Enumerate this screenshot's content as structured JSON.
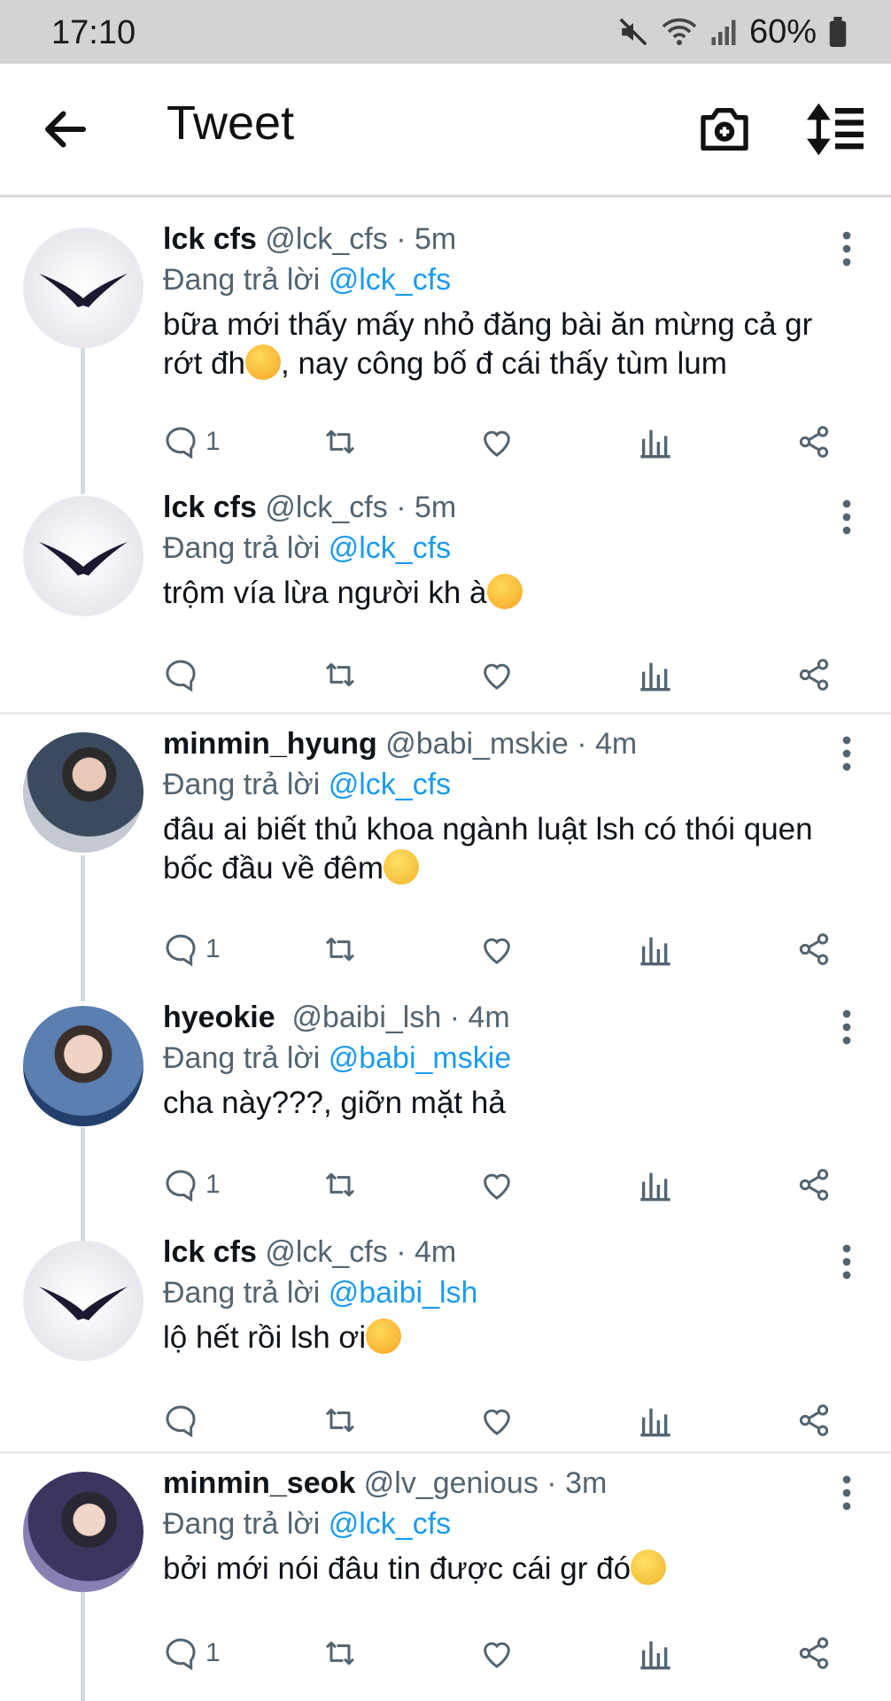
{
  "status_bar": {
    "time": "17:10",
    "battery": "60%"
  },
  "header": {
    "title": "Tweet"
  },
  "tweets": [
    {
      "name": "lck cfs",
      "handle": "@lck_cfs",
      "time": "5m",
      "reply_prefix": "Đang trả lời",
      "reply_to": "@lck_cfs",
      "text": "bữa mới thấy mấy nhỏ đăng bài ăn mừng cả gr rớt đh",
      "text_after_emoji": ", nay công bố đ cái thấy tùm lum",
      "reply_count": "1"
    },
    {
      "name": "lck cfs",
      "handle": "@lck_cfs",
      "time": "5m",
      "reply_prefix": "Đang trả lời",
      "reply_to": "@lck_cfs",
      "text": "trộm vía lừa người kh à",
      "reply_count": ""
    },
    {
      "name": "minmin_hyung",
      "handle": "@babi_mskie",
      "time": "4m",
      "reply_prefix": "Đang trả lời",
      "reply_to": "@lck_cfs",
      "text": "đâu ai biết thủ khoa ngành luật lsh có thói quen bốc đầu về đêm",
      "reply_count": "1"
    },
    {
      "name": "hyeokie",
      "handle": "@baibi_lsh",
      "time": "4m",
      "reply_prefix": "Đang trả lời",
      "reply_to": "@babi_mskie",
      "text": "cha này???, giỡn mặt hả",
      "reply_count": "1"
    },
    {
      "name": "lck cfs",
      "handle": "@lck_cfs",
      "time": "4m",
      "reply_prefix": "Đang trả lời",
      "reply_to": "@baibi_lsh",
      "text": "lộ hết rồi lsh ơi",
      "reply_count": ""
    },
    {
      "name": "minmin_seok",
      "handle": "@lv_genious",
      "time": "3m",
      "reply_prefix": "Đang trả lời",
      "reply_to": "@lck_cfs",
      "text": "bởi mới nói đâu tin được cái gr đó",
      "reply_count": "1"
    }
  ],
  "colors": {
    "mention": "#1d9bf0",
    "secondary": "#536471",
    "status_bar": "#d3d3d3"
  }
}
